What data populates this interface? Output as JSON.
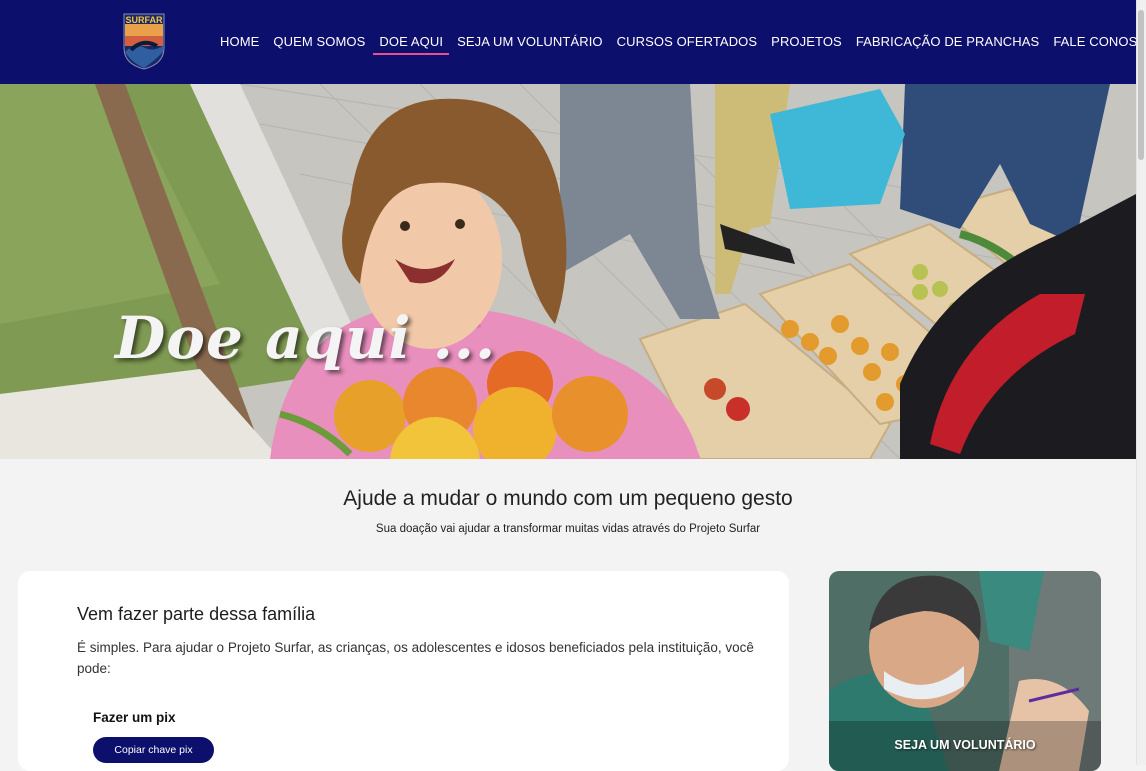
{
  "brand": {
    "logo_text": "SURFAR"
  },
  "nav": {
    "items": [
      {
        "label": "HOME"
      },
      {
        "label": "QUEM SOMOS"
      },
      {
        "label": "DOE AQUI"
      },
      {
        "label": "SEJA UM VOLUNTÁRIO"
      },
      {
        "label": "CURSOS OFERTADOS"
      },
      {
        "label": "PROJETOS"
      },
      {
        "label": "FABRICAÇÃO DE PRANCHAS"
      },
      {
        "label": "FALE CONOSCO"
      }
    ],
    "active_label": "DOE AQUI",
    "background": "#0c0f6b",
    "accent": "#e6508c"
  },
  "hero": {
    "title": "Doe aqui ..."
  },
  "intro": {
    "title": "Ajude a mudar o mundo com um pequeno gesto",
    "subtitle": "Sua doação vai ajudar a transformar muitas vidas através do Projeto Surfar"
  },
  "card": {
    "title": "Vem fazer parte dessa família",
    "text": "É simples. Para ajudar o Projeto Surfar, as crianças, os adolescentes e idosos beneficiados pela instituição, você pode:",
    "pix_title": "Fazer um pix",
    "pix_button": "Copiar chave pix"
  },
  "side": {
    "label": "SEJA UM VOLUNTÁRIO"
  }
}
